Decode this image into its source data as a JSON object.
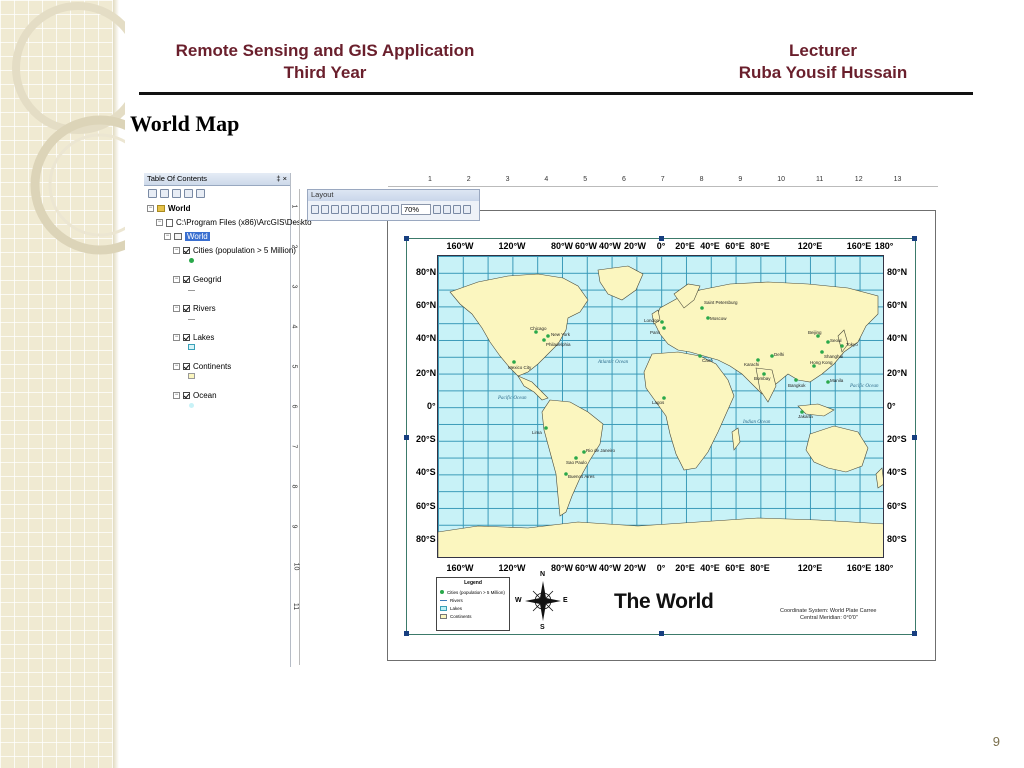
{
  "header": {
    "course": "Remote Sensing and GIS Application",
    "year": "Third Year",
    "lecturer_label": "Lecturer",
    "lecturer_name": "Ruba Yousif Hussain"
  },
  "slide_title": "World Map",
  "page_number": "9",
  "arcgis": {
    "toc": {
      "title": "Table Of Contents",
      "title_controls": "‡ ×",
      "root": "World",
      "path": "C:\\Program Files (x86)\\ArcGIS\\Deskto",
      "dataframe": "World",
      "layers": [
        {
          "label": "Cities (population > 5 Million)",
          "symbol": "green-dot"
        },
        {
          "label": "Geogrid",
          "symbol": "line"
        },
        {
          "label": "Rivers",
          "symbol": "line"
        },
        {
          "label": "Lakes",
          "symbol": "cyan-square"
        },
        {
          "label": "Continents",
          "symbol": "yellow-square"
        },
        {
          "label": "Ocean",
          "symbol": "light-cyan-dot"
        }
      ]
    },
    "layout_toolbar": {
      "title": "Layout",
      "zoom": "70%"
    },
    "ruler_top": [
      "1",
      "2",
      "3",
      "4",
      "5",
      "6",
      "7",
      "8",
      "9",
      "10",
      "11",
      "12",
      "13"
    ],
    "ruler_left": [
      "1",
      "2",
      "3",
      "4",
      "5",
      "6",
      "7",
      "8",
      "9",
      "10",
      "11"
    ],
    "map": {
      "top_lon_labels": [
        "160°W",
        "120°W",
        "80°W",
        "60°W",
        "40°W",
        "20°W",
        "0°",
        "20°E",
        "40°E",
        "60°E",
        "80°E",
        "120°E",
        "160°E",
        "180°"
      ],
      "bottom_lon_labels": [
        "160°W",
        "120°W",
        "80°W",
        "60°W",
        "40°W",
        "20°W",
        "0°",
        "20°E",
        "40°E",
        "60°E",
        "80°E",
        "120°E",
        "160°E",
        "180°"
      ],
      "lat_labels": [
        "80°N",
        "60°N",
        "40°N",
        "20°N",
        "0°",
        "20°S",
        "40°S",
        "60°S",
        "80°S"
      ],
      "oceans": [
        "Atlantic Ocean",
        "Pacific Ocean",
        "Indian Ocean",
        "Pacific Ocean"
      ],
      "cities": [
        "Saint Petersburg",
        "Moscow",
        "Chicago",
        "New York",
        "Philadelphia",
        "Mexico City",
        "London",
        "Paris",
        "Beijing",
        "Seoul",
        "Tokyo",
        "Shanghai",
        "Karachi",
        "Delhi",
        "Bombay",
        "Hong Kong",
        "Bangkok",
        "Manila",
        "Jakarta",
        "Rio de Janeiro",
        "Sao Paulo",
        "Buenos Aires",
        "Lima",
        "Cairo",
        "Lagos"
      ],
      "legend": {
        "title": "Legend",
        "items": [
          {
            "label": "Cities (population > 5 Million)",
            "color": "#2aa84a"
          },
          {
            "label": "Rivers",
            "color": "#3a7ab8"
          },
          {
            "label": "Lakes",
            "color": "#bff0f6"
          },
          {
            "label": "Continents",
            "color": "#fbf6bf"
          }
        ]
      },
      "compass": {
        "n": "N",
        "s": "S",
        "e": "E",
        "w": "W"
      },
      "title": "The World",
      "coord_system": "Coordinate System: World Plate Carree",
      "central_meridian": "Central Meridian: 0°0'0\""
    }
  },
  "colors": {
    "header_text": "#6a1f2c",
    "land": "#fbf6bf",
    "ocean": "#c8f2f7",
    "grid": "#3a9ab8"
  }
}
